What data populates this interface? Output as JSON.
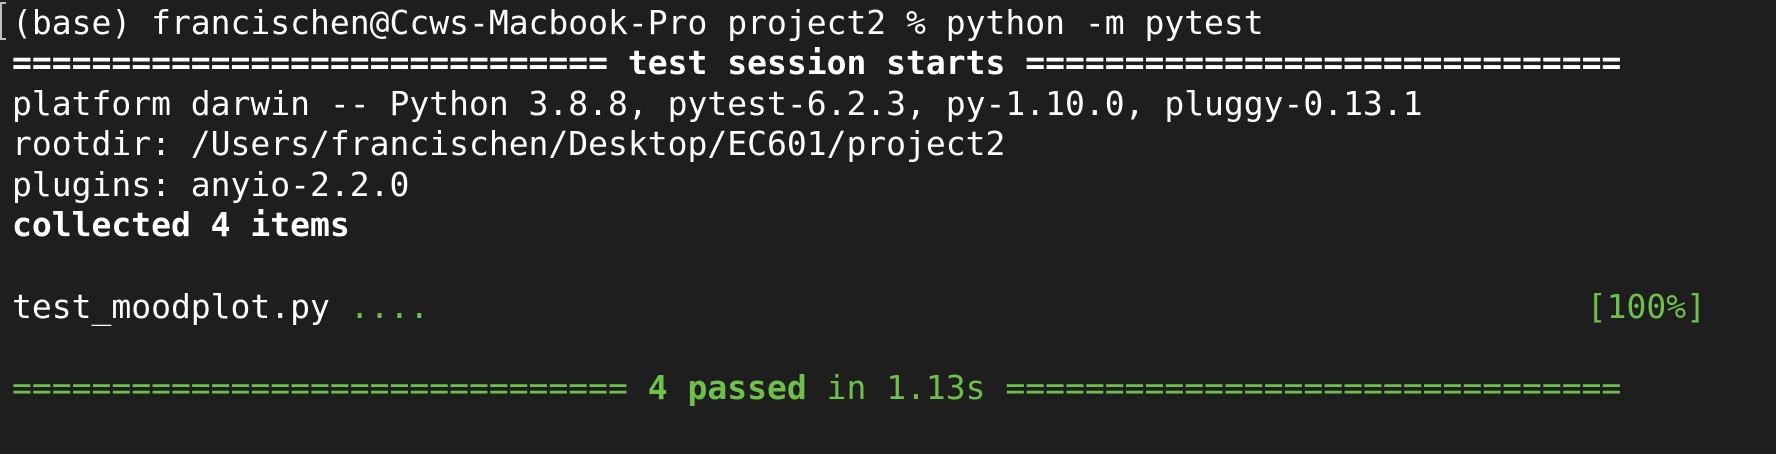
{
  "terminal": {
    "prompt": "(base) francischen@Ccws-Macbook-Pro project2 % python -m pytest",
    "header_left": "============================== ",
    "header_title": "test session starts",
    "header_right": " ==============================",
    "platform": "platform darwin -- Python 3.8.8, pytest-6.2.3, py-1.10.0, pluggy-0.13.1",
    "rootdir": "rootdir: /Users/francischen/Desktop/EC601/project2",
    "plugins": "plugins: anyio-2.2.0",
    "collected": "collected 4 items",
    "test_file": "test_moodplot.py ",
    "test_dots": "....",
    "test_percent": "[100%]",
    "footer_left": "=============================== ",
    "footer_passed": "4 passed",
    "footer_time": " in 1.13s",
    "footer_right": " ==============================="
  },
  "colors": {
    "background": "#1e1e1e",
    "text": "#ffffff",
    "success": "#6ec04a"
  }
}
